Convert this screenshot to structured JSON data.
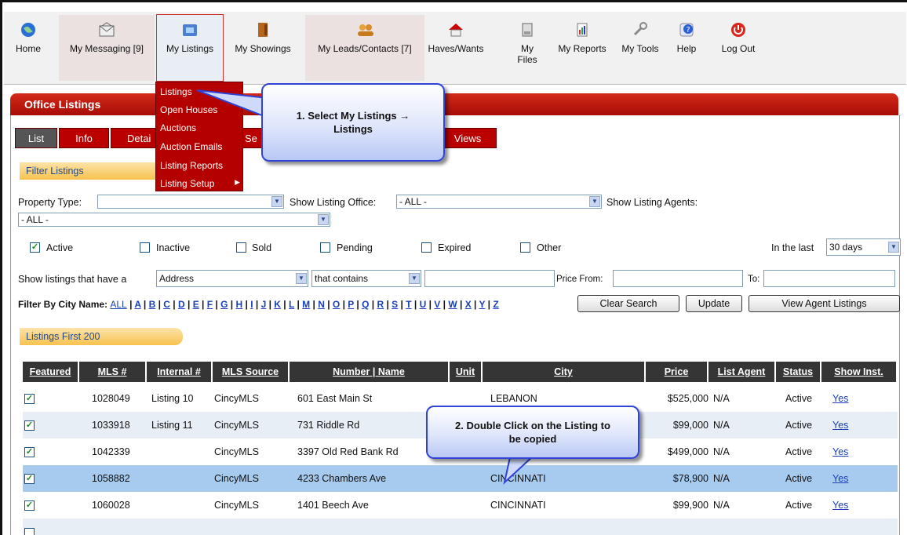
{
  "nav": {
    "items": [
      {
        "label": "Home",
        "icon": "globe-icon"
      },
      {
        "label": "My Messaging [9]",
        "icon": "envelope-icon"
      },
      {
        "label": "My Listings",
        "icon": "listings-icon"
      },
      {
        "label": "My Showings",
        "icon": "showings-icon"
      },
      {
        "label": "My Leads/Contacts [7]",
        "icon": "contacts-icon"
      },
      {
        "label": "Haves/Wants",
        "icon": "house-icon"
      },
      {
        "label": "My Files",
        "icon": "files-icon"
      },
      {
        "label": "My Reports",
        "icon": "reports-icon"
      },
      {
        "label": "My Tools",
        "icon": "wrench-icon"
      },
      {
        "label": "Help",
        "icon": "help-icon"
      },
      {
        "label": "Log Out",
        "icon": "power-icon"
      }
    ],
    "files_line1": "My",
    "files_line2": "Files"
  },
  "page": {
    "title": "Office Listings"
  },
  "tabs": {
    "list": "List",
    "info": "Info",
    "details": "Detai",
    "search": "Se",
    "views": "Views"
  },
  "menu": {
    "items": [
      "Listings",
      "Open Houses",
      "Auctions",
      "Auction Emails",
      "Listing Reports",
      "Listing Setup"
    ]
  },
  "callouts": {
    "one_line1": "1. Select My Listings →",
    "one_line2": "Listings",
    "two_line1": "2. Double Click on the Listing to",
    "two_line2": "be copied"
  },
  "filter": {
    "section_title": "Filter Listings",
    "property_type_label": "Property Type:",
    "property_type_value": "",
    "office_label": "Show Listing Office:",
    "office_value": "- ALL -",
    "agents_label": "Show Listing Agents:",
    "agents_value": "- ALL -",
    "statuses": [
      {
        "label": "Active",
        "checked": true
      },
      {
        "label": "Inactive",
        "checked": false
      },
      {
        "label": "Sold",
        "checked": false
      },
      {
        "label": "Pending",
        "checked": false
      },
      {
        "label": "Expired",
        "checked": false
      },
      {
        "label": "Other",
        "checked": false
      }
    ],
    "in_last_label": "In the last",
    "in_last_value": "30 days",
    "have_label": "Show listings that have a",
    "have_value": "Address",
    "contains_value": "that contains",
    "price_from_label": "Price From:",
    "to_label": "To:",
    "city_label": "Filter By City Name:",
    "city_all": "ALL",
    "city_letters": [
      "A",
      "B",
      "C",
      "D",
      "E",
      "F",
      "G",
      "H",
      "I",
      "J",
      "K",
      "L",
      "M",
      "N",
      "O",
      "P",
      "Q",
      "R",
      "S",
      "T",
      "U",
      "V",
      "W",
      "X",
      "Y",
      "Z"
    ],
    "clear_button": "Clear Search",
    "update_button": "Update",
    "view_agent_button": "View Agent Listings"
  },
  "listings": {
    "section_title": "Listings First 200",
    "headers": [
      "Featured",
      "MLS #",
      "Internal #",
      "MLS Source",
      "Number | Name",
      "Unit",
      "City",
      "Price",
      "List Agent",
      "Status",
      "Show Inst."
    ],
    "rows": [
      {
        "featured": true,
        "mls": "1028049",
        "internal": "Listing 10",
        "source": "CincyMLS",
        "name": "601 East Main St",
        "unit": "",
        "city": "LEBANON",
        "price": "$525,000",
        "agent": "N/A",
        "status": "Active",
        "show": "Yes"
      },
      {
        "featured": true,
        "mls": "1033918",
        "internal": "Listing 11",
        "source": "CincyMLS",
        "name": "731 Riddle Rd",
        "unit": "",
        "city": "",
        "price": "$99,000",
        "agent": "N/A",
        "status": "Active",
        "show": "Yes"
      },
      {
        "featured": true,
        "mls": "1042339",
        "internal": "",
        "source": "CincyMLS",
        "name": "3397 Old Red Bank Rd",
        "unit": "",
        "city": "",
        "price": "$499,000",
        "agent": "N/A",
        "status": "Active",
        "show": "Yes"
      },
      {
        "featured": true,
        "mls": "1058882",
        "internal": "",
        "source": "CincyMLS",
        "name": "4233 Chambers Ave",
        "unit": "",
        "city": "CINCINNATI",
        "price": "$78,900",
        "agent": "N/A",
        "status": "Active",
        "show": "Yes"
      },
      {
        "featured": true,
        "mls": "1060028",
        "internal": "",
        "source": "CincyMLS",
        "name": "1401 Beech Ave",
        "unit": "",
        "city": "CINCINNATI",
        "price": "$99,900",
        "agent": "N/A",
        "status": "Active",
        "show": "Yes"
      }
    ]
  },
  "colors": {
    "brand_red": "#b50000",
    "callout_border": "#2f43d6",
    "highlight_row": "#a6cbef",
    "link": "#1a3fb5"
  }
}
